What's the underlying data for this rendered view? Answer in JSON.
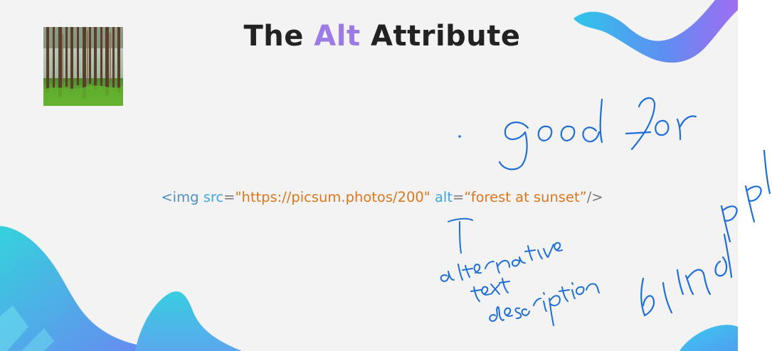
{
  "slide": {
    "title": {
      "before": "The",
      "accent": "Alt",
      "after": "Attribute"
    },
    "image_description": "Pine forest photo thumbnail",
    "code": {
      "open_tag": "<img",
      "src_attr": "src",
      "eq1": "=",
      "src_value": "\"https://picsum.photos/200\"",
      "alt_attr": "alt",
      "eq2": "=",
      "alt_value": "“forest at sunset”",
      "close_tag": "/>"
    }
  },
  "colors": {
    "title_accent": "#9b7be6",
    "tag": "#4f8fc4",
    "attribute": "#42a5dd",
    "string": "#d9781f",
    "ink": "#1f6fd6",
    "wave_start": "#3fd0e0",
    "wave_end": "#8a6cf0"
  },
  "handwriting_note": "Handwritten annotations drawn as ink strokes"
}
